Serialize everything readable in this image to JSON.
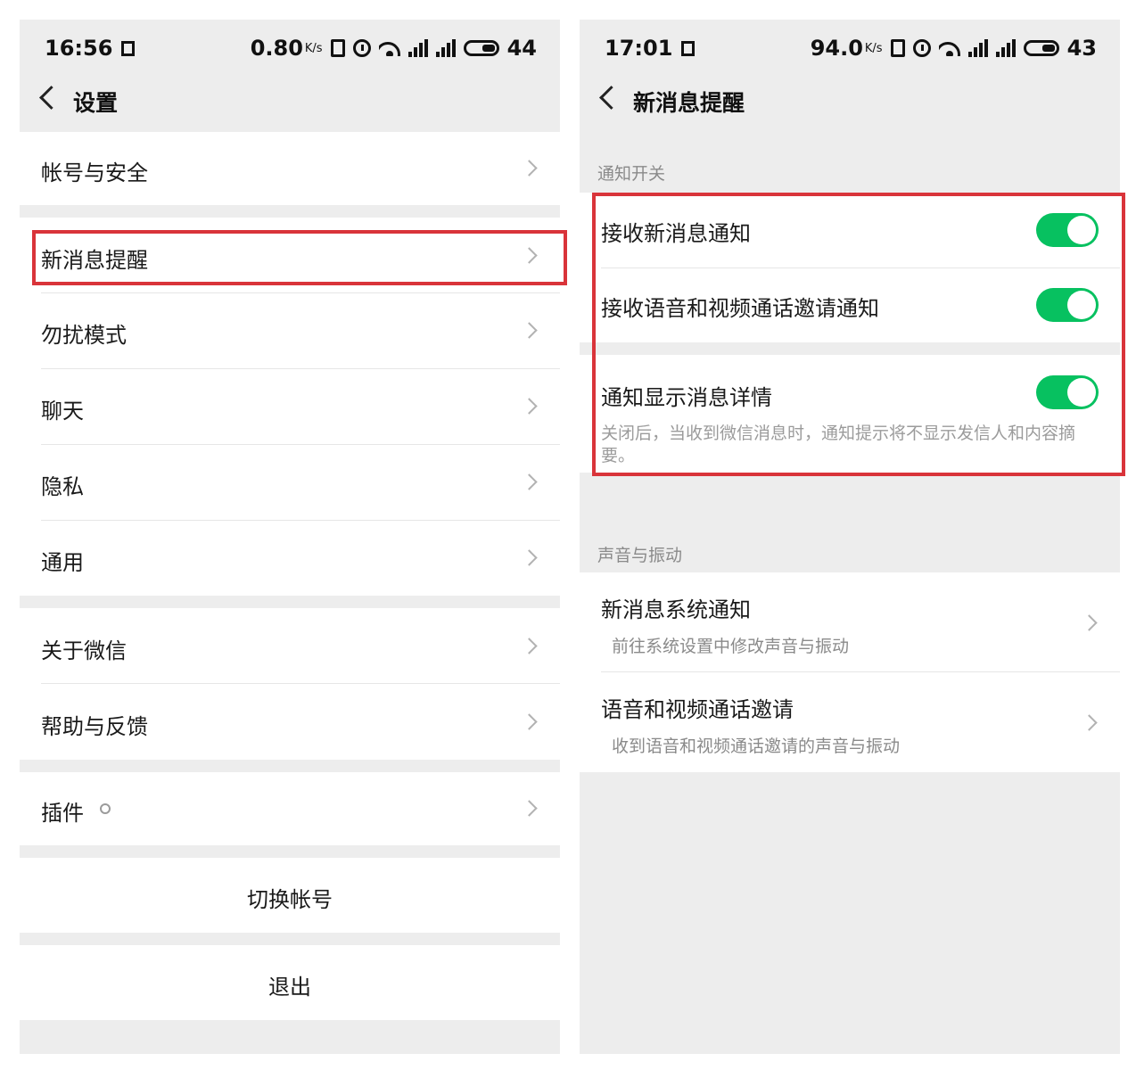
{
  "left_screen": {
    "status": {
      "time": "16:56",
      "speed": "0.80",
      "speed_unit": "K/s",
      "battery": "44"
    },
    "nav": {
      "title": "设置"
    },
    "items": {
      "account": "帐号与安全",
      "new_message": "新消息提醒",
      "dnd": "勿扰模式",
      "chat": "聊天",
      "privacy": "隐私",
      "general": "通用",
      "about": "关于微信",
      "help": "帮助与反馈",
      "plugins": "插件"
    },
    "switch_account": "切换帐号",
    "logout": "退出"
  },
  "right_screen": {
    "status": {
      "time": "17:01",
      "speed": "94.0",
      "speed_unit": "K/s",
      "battery": "43"
    },
    "nav": {
      "title": "新消息提醒"
    },
    "notify_section": {
      "title": "通知开关",
      "receive_new": {
        "label": "接收新消息通知",
        "on": true
      },
      "receive_call": {
        "label": "接收语音和视频通话邀请通知",
        "on": true
      },
      "show_detail": {
        "label": "通知显示消息详情",
        "on": true,
        "desc": "关闭后，当收到微信消息时，通知提示将不显示发信人和内容摘要。"
      }
    },
    "sound_section": {
      "title": "声音与振动",
      "system_notify": {
        "label": "新消息系统通知",
        "sub": "前往系统设置中修改声音与振动"
      },
      "call_invite": {
        "label": "语音和视频通话邀请",
        "sub": "收到语音和视频通话邀请的声音与振动"
      }
    }
  },
  "colors": {
    "toggle_on": "#07c160",
    "highlight": "#d9343a",
    "page_bg": "#ededed"
  }
}
